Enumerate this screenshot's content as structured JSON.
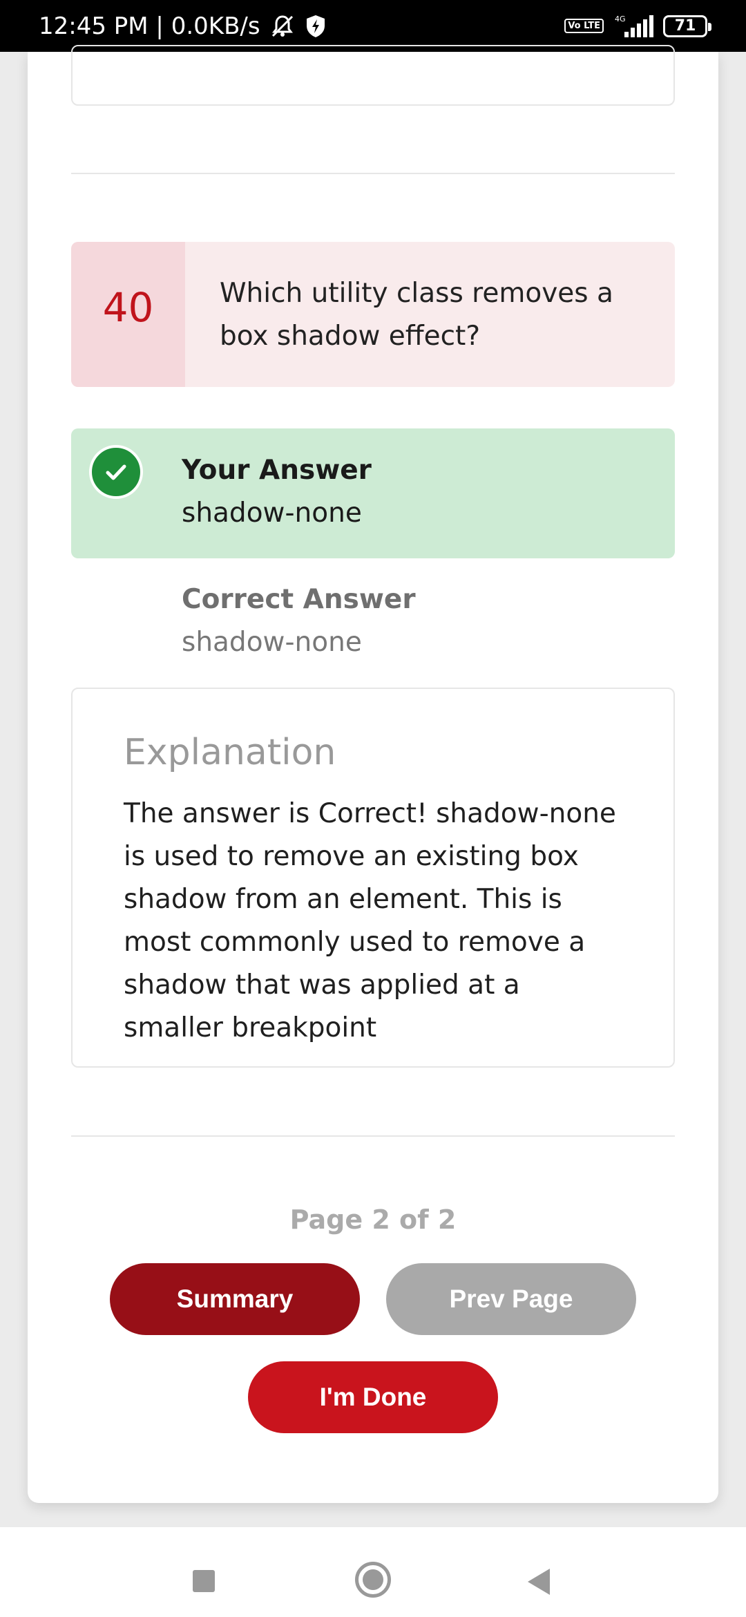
{
  "status_bar": {
    "time_speed": "12:45 PM | 0.0KB/s",
    "volte": "Vo LTE",
    "network": "4G",
    "battery": "71"
  },
  "question": {
    "number": "40",
    "text": "Which utility class removes a box shadow effect?"
  },
  "your_answer": {
    "label": "Your Answer",
    "value": "shadow-none"
  },
  "correct_answer": {
    "label": "Correct Answer",
    "value": "shadow-none"
  },
  "explanation": {
    "title": "Explanation",
    "body": "The answer is Correct! shadow-none is used to remove an existing box shadow from an element. This is most commonly used to remove a shadow that was applied at a smaller breakpoint"
  },
  "pagination": {
    "indicator": "Page 2 of 2"
  },
  "buttons": {
    "summary": "Summary",
    "prev_page": "Prev Page",
    "done": "I'm Done"
  },
  "colors": {
    "brand_red": "#c9141d",
    "dark_red": "#970f17",
    "correct_green": "#1f8f3a",
    "correct_bg": "#cdebd4"
  }
}
